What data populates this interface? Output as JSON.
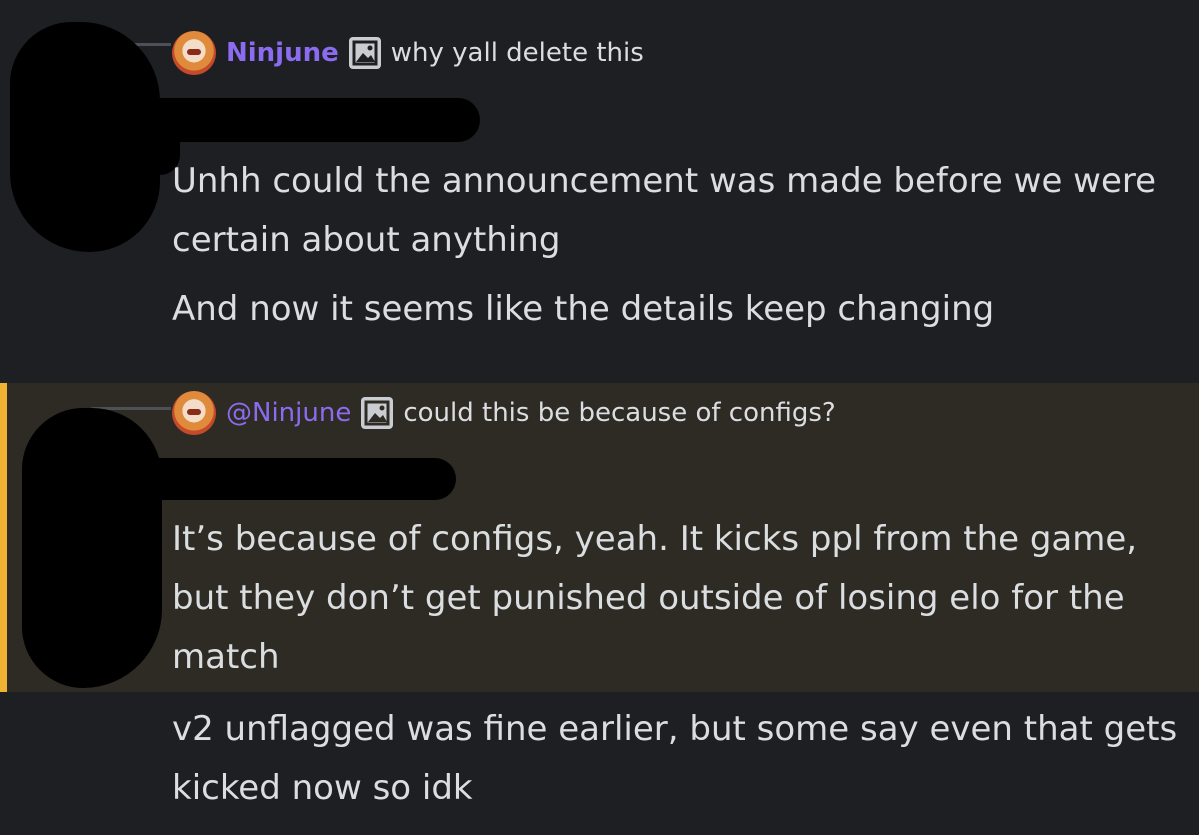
{
  "messages": [
    {
      "reply": {
        "author": "Ninjune",
        "snippet": "why yall delete this"
      },
      "lines": [
        "Unhh could the announcement was made before we were certain about anything",
        "And now it seems like the details keep changing"
      ]
    },
    {
      "mention_color": "#f0b232",
      "reply": {
        "author": "@Ninjune",
        "snippet": "could this be because of configs?"
      },
      "lines": [
        "It’s because of configs, yeah. It kicks ppl from the game, but they don’t get punished outside of losing elo for the match"
      ]
    },
    {
      "lines": [
        "v2 unflagged was fine earlier, but some say even that gets kicked now so idk"
      ]
    }
  ],
  "icons": {
    "avatar": "avatar-icon",
    "image": "image-icon"
  }
}
